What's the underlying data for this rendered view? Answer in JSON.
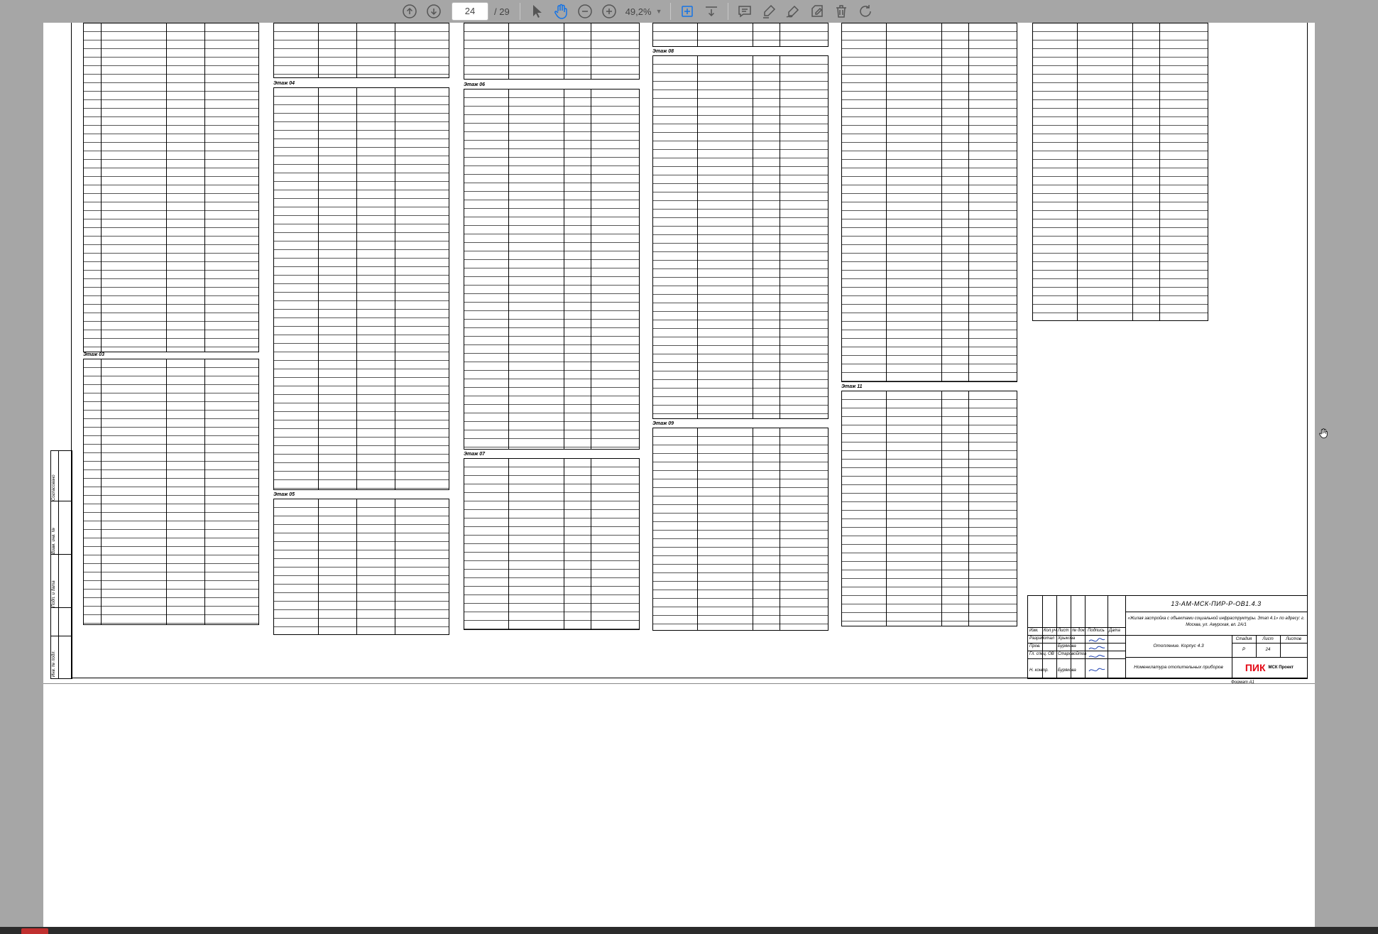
{
  "toolbar": {
    "page_current": "24",
    "page_total": "/ 29",
    "zoom": "49,2%",
    "tools": [
      "arrow-up-circle-icon",
      "arrow-down-circle-icon",
      "cursor-select-icon",
      "hand-tool-icon",
      "zoom-out-icon",
      "zoom-in-icon",
      "fit-page-icon",
      "scroll-mode-icon",
      "comment-icon",
      "highlight-icon",
      "draw-icon",
      "fill-sign-icon",
      "delete-icon",
      "rotate-icon"
    ]
  },
  "sheet": {
    "floor_labels": [
      "Этаж 03",
      "Этаж 04",
      "Этаж 05",
      "Этаж 06",
      "Этаж 07",
      "Этаж 08",
      "Этаж 09",
      "Этаж 11"
    ],
    "side_stamp": [
      "Согласовано",
      "Взам. инв. №",
      "Подп. и дата",
      "Инв. № подл."
    ]
  },
  "titleblock": {
    "doc_code": "13-АМ-МСК-ПИР-Р-ОВ1.4.3",
    "project_name": "«Жилая застройка с объектами социальной инфраструктуры. Этап 4.1» по адресу: г. Москва, ул. Амурская, вл. 2А/1",
    "header_cells": [
      "Изм.",
      "Кол.уч",
      "Лист",
      "№ док.",
      "Подпись",
      "Дата"
    ],
    "roles": [
      "Разработал",
      "Пров.",
      "Гл. спец. ОВ",
      "Н. контр."
    ],
    "names": [
      "Хрыкова",
      "Бурякова",
      "Старовойтов",
      "Бурякова"
    ],
    "section": "Отопление. Корпус 4.3",
    "stage_header": "Стадия",
    "sheet_header": "Лист",
    "sheets_header": "Листов",
    "stage_value": "Р",
    "sheet_value": "24",
    "description": "Номенклатура отопительных приборов",
    "logo": "ПИК",
    "logo_sub": "МСК Проект",
    "format": "Формат А1"
  }
}
